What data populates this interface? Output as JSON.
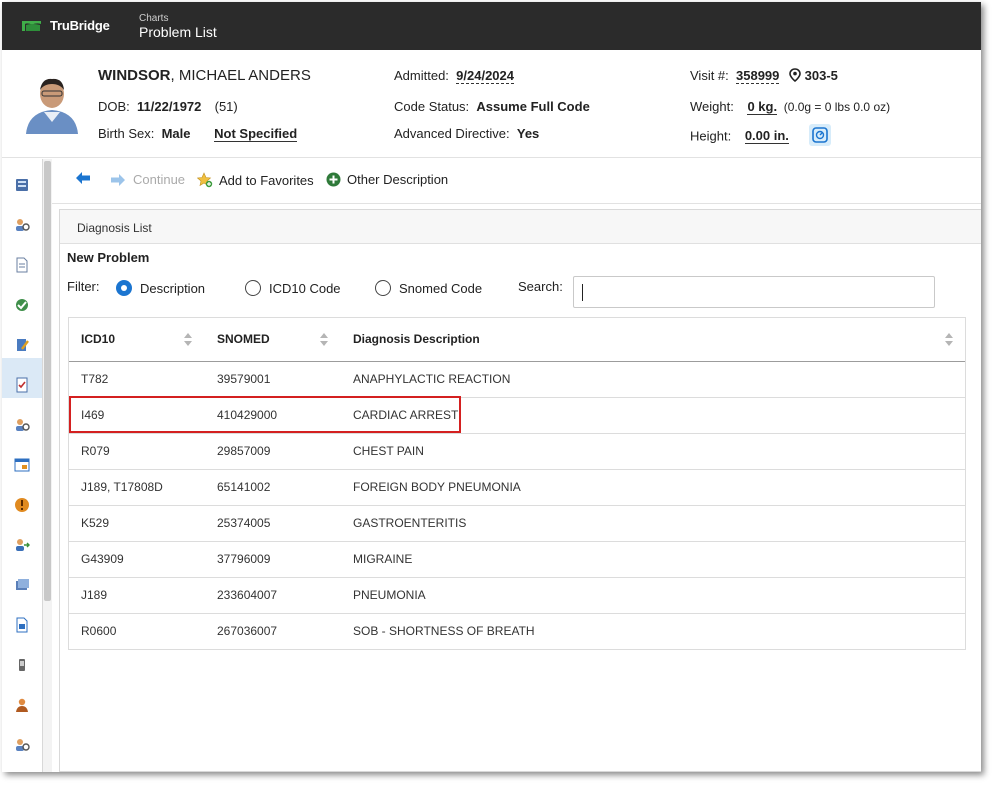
{
  "app": {
    "brand": "TruBridge",
    "section": "Charts",
    "page_title": "Problem List"
  },
  "patient": {
    "last_name": "WINDSOR",
    "first_names": "MICHAEL ANDERS",
    "dob_label": "DOB:",
    "dob": "11/22/1972",
    "age": "(51)",
    "birth_sex_label": "Birth Sex:",
    "birth_sex": "Male",
    "gender_identity": "Not Specified",
    "admitted_label": "Admitted:",
    "admitted": "9/24/2024",
    "code_status_label": "Code Status:",
    "code_status": "Assume Full Code",
    "advanced_directive_label": "Advanced Directive:",
    "advanced_directive": "Yes",
    "visit_label": "Visit #:",
    "visit_number": "358999",
    "room": "303-5",
    "weight_label": "Weight:",
    "weight": "0 kg.",
    "weight_detail": "(0.0g = 0 lbs 0.0 oz)",
    "height_label": "Height:",
    "height": "0.00 in."
  },
  "toolbar": {
    "continue_label": "Continue",
    "favorites_label": "Add to Favorites",
    "other_label": "Other Description"
  },
  "panel": {
    "title": "Diagnosis List",
    "subtitle": "New Problem",
    "filter_label": "Filter:",
    "filter_options": [
      "Description",
      "ICD10 Code",
      "Snomed Code"
    ],
    "selected_filter": "Description",
    "search_label": "Search:",
    "search_value": ""
  },
  "table": {
    "columns": [
      "ICD10",
      "SNOMED",
      "Diagnosis Description"
    ],
    "rows": [
      [
        "T782",
        "39579001",
        "ANAPHYLACTIC REACTION"
      ],
      [
        "I469",
        "410429000",
        "CARDIAC ARREST"
      ],
      [
        "R079",
        "29857009",
        "CHEST PAIN"
      ],
      [
        "J189, T17808D",
        "65141002",
        "FOREIGN BODY PNEUMONIA"
      ],
      [
        "K529",
        "25374005",
        "GASTROENTERITIS"
      ],
      [
        "G43909",
        "37796009",
        "MIGRAINE"
      ],
      [
        "J189",
        "233604007",
        "PNEUMONIA"
      ],
      [
        "R0600",
        "267036007",
        "SOB - SHORTNESS OF BREATH"
      ]
    ],
    "highlighted_row": 1
  },
  "colors": {
    "topbar": "#2b2b2b",
    "accent": "#1b75d0",
    "highlight": "#d42020",
    "brand_green": "#3fae49"
  }
}
